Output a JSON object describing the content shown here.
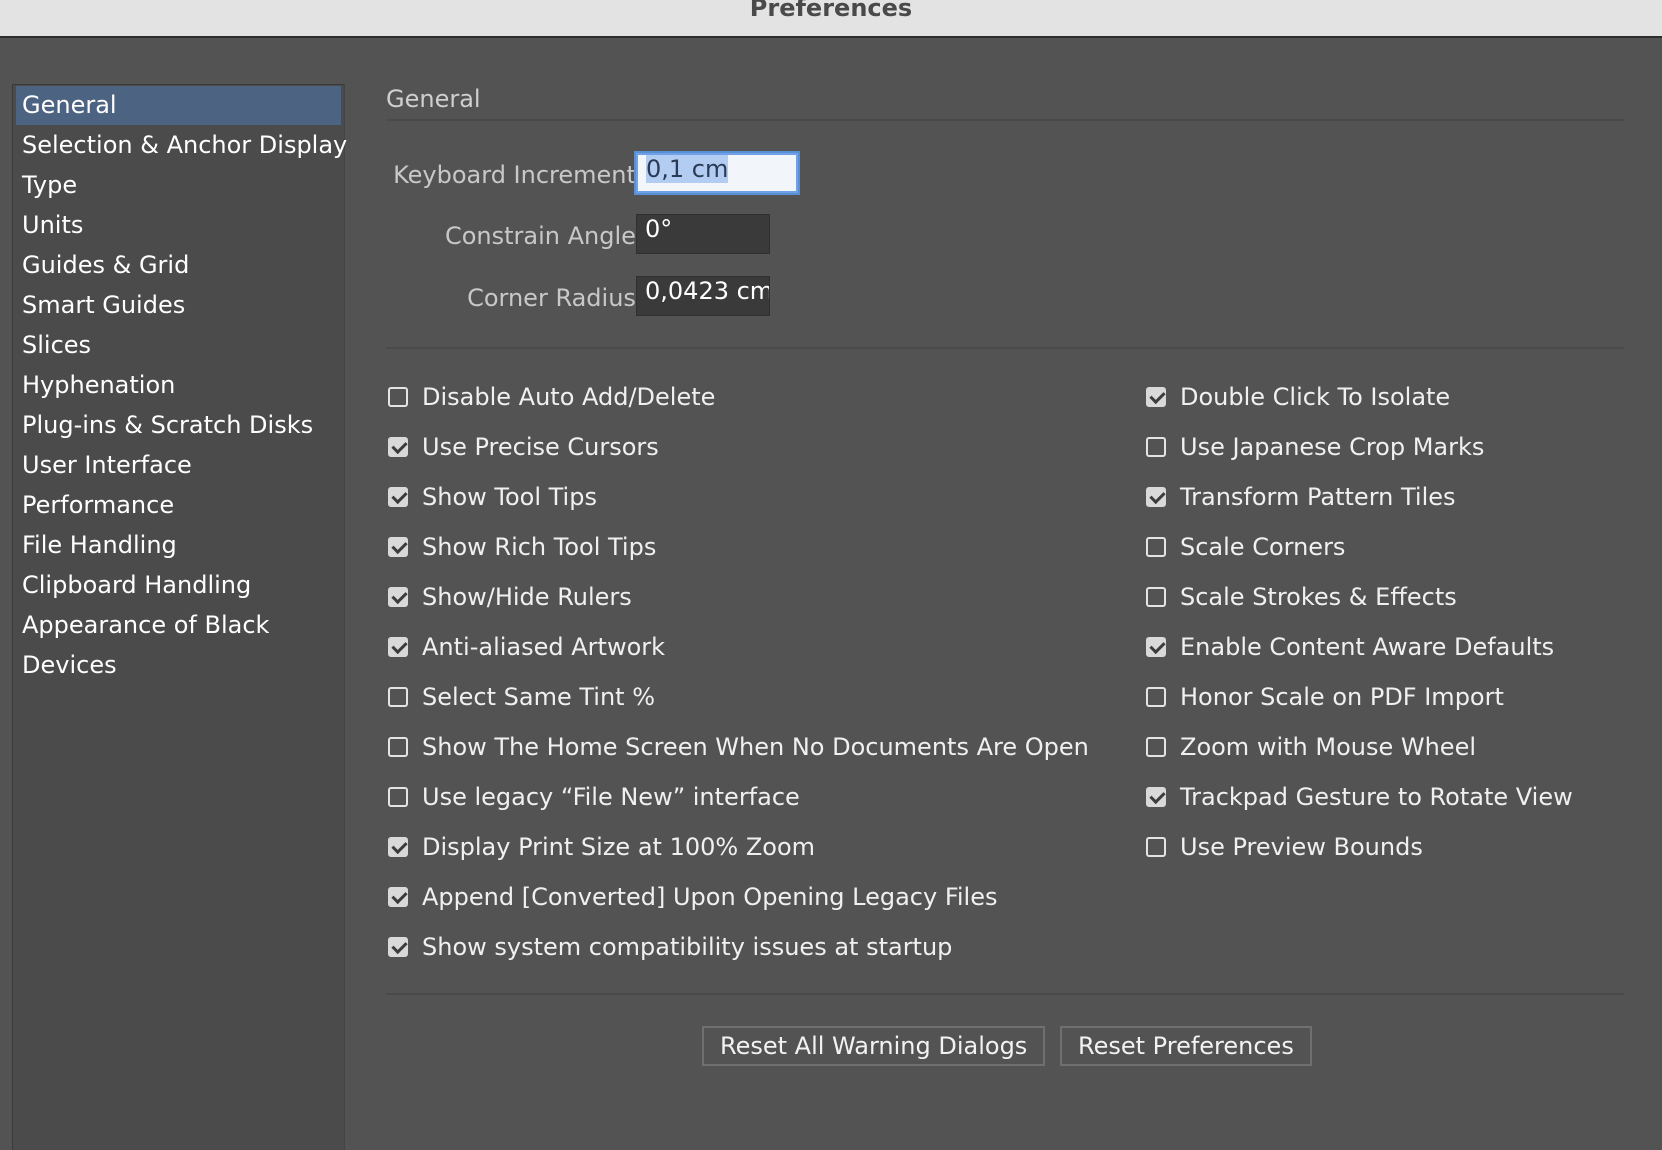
{
  "window": {
    "title": "Preferences"
  },
  "sidebar": {
    "items": [
      {
        "label": "General",
        "selected": true
      },
      {
        "label": "Selection & Anchor Display"
      },
      {
        "label": "Type"
      },
      {
        "label": "Units"
      },
      {
        "label": "Guides & Grid"
      },
      {
        "label": "Smart Guides"
      },
      {
        "label": "Slices"
      },
      {
        "label": "Hyphenation"
      },
      {
        "label": "Plug-ins & Scratch Disks"
      },
      {
        "label": "User Interface"
      },
      {
        "label": "Performance"
      },
      {
        "label": "File Handling"
      },
      {
        "label": "Clipboard Handling"
      },
      {
        "label": "Appearance of Black"
      },
      {
        "label": "Devices"
      }
    ]
  },
  "main": {
    "section_title": "General",
    "fields": {
      "keyboard_increment": {
        "label": "Keyboard Increment:",
        "value": "0,1 cm"
      },
      "constrain_angle": {
        "label": "Constrain Angle:",
        "value": "0°"
      },
      "corner_radius": {
        "label": "Corner Radius:",
        "value": "0,0423 cm"
      }
    },
    "left_checkboxes": [
      {
        "label": "Disable Auto Add/Delete",
        "checked": false
      },
      {
        "label": "Use Precise Cursors",
        "checked": true
      },
      {
        "label": "Show Tool Tips",
        "checked": true
      },
      {
        "label": "Show Rich Tool Tips",
        "checked": true
      },
      {
        "label": "Show/Hide Rulers",
        "checked": true
      },
      {
        "label": "Anti-aliased Artwork",
        "checked": true
      },
      {
        "label": "Select Same Tint %",
        "checked": false
      },
      {
        "label": "Show The Home Screen When No Documents Are Open",
        "checked": false
      },
      {
        "label": "Use legacy “File New” interface",
        "checked": false
      },
      {
        "label": "Display Print Size at 100% Zoom",
        "checked": true
      },
      {
        "label": "Append [Converted] Upon Opening Legacy Files",
        "checked": true
      },
      {
        "label": "Show system compatibility issues at startup",
        "checked": true
      }
    ],
    "right_checkboxes": [
      {
        "label": "Double Click To Isolate",
        "checked": true
      },
      {
        "label": "Use Japanese Crop Marks",
        "checked": false
      },
      {
        "label": "Transform Pattern Tiles",
        "checked": true
      },
      {
        "label": "Scale Corners",
        "checked": false
      },
      {
        "label": "Scale Strokes & Effects",
        "checked": false
      },
      {
        "label": "Enable Content Aware Defaults",
        "checked": true
      },
      {
        "label": "Honor Scale on PDF Import",
        "checked": false
      },
      {
        "label": "Zoom with Mouse Wheel",
        "checked": false
      },
      {
        "label": "Trackpad Gesture to Rotate View",
        "checked": true
      },
      {
        "label": "Use Preview Bounds",
        "checked": false
      }
    ],
    "buttons": {
      "reset_warnings": "Reset All Warning Dialogs",
      "reset_preferences": "Reset Preferences"
    }
  },
  "colors": {
    "background": "#535353",
    "sidebar_bg": "#4b4b4b",
    "selection": "#4c6382",
    "focus_ring": "#5a8fd6",
    "titlebar": "#e3e3e3"
  }
}
